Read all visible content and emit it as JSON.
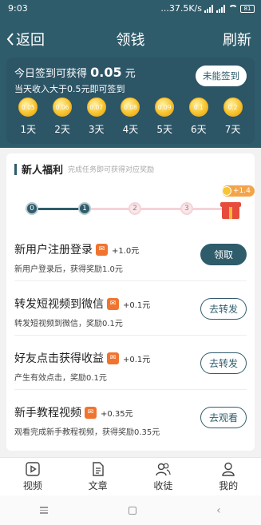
{
  "status_bar": {
    "time": "9:03",
    "network": "...37.5K/s",
    "battery": "81"
  },
  "nav": {
    "back_label": "返回",
    "title": "领钱",
    "refresh_label": "刷新"
  },
  "signin": {
    "title_prefix": "今日签到可获得",
    "amount": "0.05",
    "unit": "元",
    "subtitle": "当天收入大于0.5元即可签到",
    "button_label": "未能签到",
    "days": [
      {
        "coin": "0.05",
        "label": "1天"
      },
      {
        "coin": "0.06",
        "label": "2天"
      },
      {
        "coin": "0.07",
        "label": "3天"
      },
      {
        "coin": "0.08",
        "label": "4天"
      },
      {
        "coin": "0.09",
        "label": "5天"
      },
      {
        "coin": "0.1",
        "label": "6天"
      },
      {
        "coin": "0.2",
        "label": "7天"
      }
    ]
  },
  "newbie": {
    "title": "新人福利",
    "subtitle": "完成任务即可获得对应奖励",
    "steps": [
      "0",
      "1",
      "2",
      "3"
    ],
    "steps_completed": 2,
    "gift_reward": "+1.4"
  },
  "tasks": [
    {
      "title": "新用户注册登录",
      "reward": "+1.0元",
      "desc": "新用户登录后，获得奖励1.0元",
      "button": "领取",
      "style": "filled"
    },
    {
      "title": "转发短视频到微信",
      "reward": "+0.1元",
      "desc": "转发短视频到微信，奖励0.1元",
      "button": "去转发",
      "style": "outline"
    },
    {
      "title": "好友点击获得收益",
      "reward": "+0.1元",
      "desc": "产生有效点击，奖励0.1元",
      "button": "去转发",
      "style": "outline"
    },
    {
      "title": "新手教程视频",
      "reward": "+0.35元",
      "desc": "观看完成新手教程视频，获得奖励0.35元",
      "button": "去观看",
      "style": "outline"
    }
  ],
  "tabbar": {
    "items": [
      {
        "label": "视频",
        "icon": "video-icon"
      },
      {
        "label": "文章",
        "icon": "article-icon"
      },
      {
        "label": "收徒",
        "icon": "apprentice-icon"
      },
      {
        "label": "我的",
        "icon": "profile-icon"
      }
    ]
  },
  "colors": {
    "brand": "#2f5c6b",
    "coin": "#f7c531",
    "reward_icon": "#f0742e"
  }
}
